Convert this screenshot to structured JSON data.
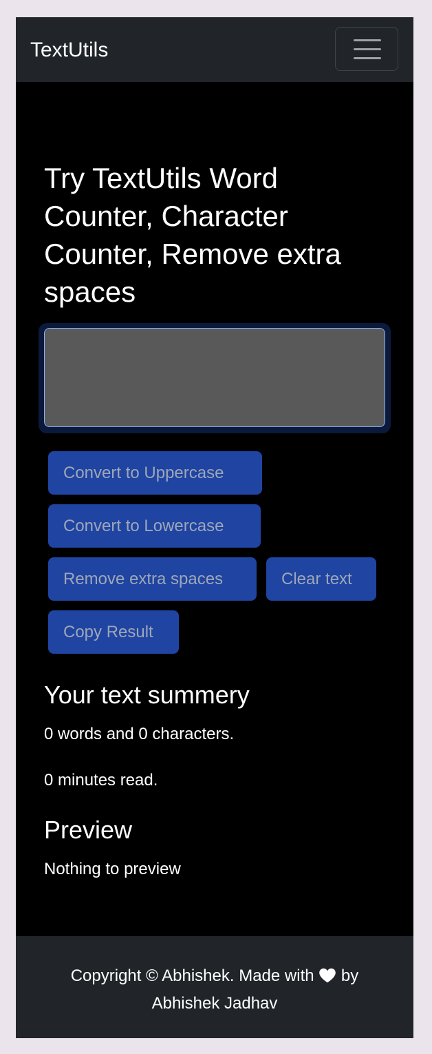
{
  "navbar": {
    "brand": "TextUtils",
    "toggler_icon": "hamburger-menu-icon"
  },
  "main": {
    "heading": "Try TextUtils Word Counter, Character Counter, Remove extra spaces",
    "textarea": {
      "value": "",
      "placeholder": ""
    },
    "buttons": {
      "uppercase": "Convert to Uppercase",
      "lowercase": "Convert to Lowercase",
      "remove_spaces": "Remove extra spaces",
      "clear": "Clear text",
      "copy": "Copy Result"
    },
    "summary": {
      "title": "Your text summery",
      "counts": "0 words and 0 characters.",
      "read_time": "0 minutes read."
    },
    "preview": {
      "title": "Preview",
      "text": "Nothing to preview"
    }
  },
  "footer": {
    "text_before": "Copyright © Abhishek. Made with",
    "heart_icon": "heart-icon",
    "text_after": "by",
    "author": "Abhishek Jadhav"
  },
  "colors": {
    "navbar_bg": "#212529",
    "page_bg": "#000000",
    "button_bg": "#1f44a2",
    "button_text": "#9ea7b7",
    "outer_bg": "#ebe4ec"
  }
}
